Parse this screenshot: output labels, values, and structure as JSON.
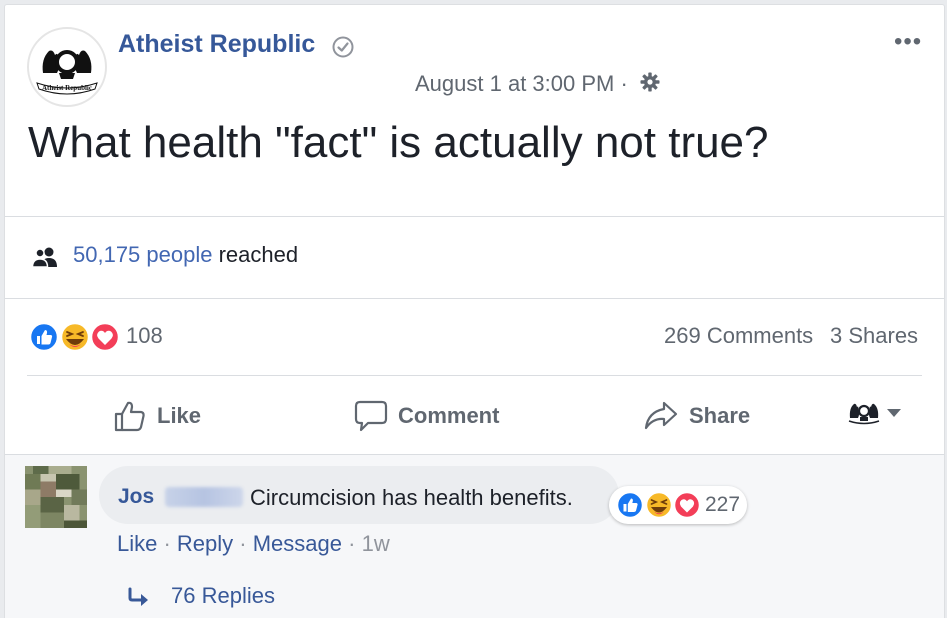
{
  "post": {
    "page_name": "Atheist Republic",
    "logo_text": "Atheist Republic",
    "timestamp": "August 1 at 3:00 PM ·",
    "text": "What health \"fact\" is actually not true?",
    "more_label": "•••"
  },
  "reach": {
    "count": "50,175 people",
    "suffix": " reached"
  },
  "stats": {
    "reaction_count": "108",
    "comments": "269 Comments",
    "shares": "3 Shares"
  },
  "actions": {
    "like": "Like",
    "comment": "Comment",
    "share": "Share"
  },
  "comment": {
    "author": "Jos",
    "text": "Circumcision has health benefits.",
    "reaction_count": "227",
    "like": "Like",
    "reply": "Reply",
    "message": "Message",
    "sep": " · ",
    "time": "1w",
    "replies": "76 Replies"
  },
  "colors": {
    "link_blue": "#365899",
    "reach_blue": "#4267b2",
    "like_blue": "#1877f2",
    "love_red": "#f33e58",
    "haha_yellow": "#f7b928"
  },
  "icons": [
    "verified-badge-icon",
    "gear-icon",
    "people-icon",
    "like-reaction-icon",
    "haha-reaction-icon",
    "love-reaction-icon",
    "thumbs-up-icon",
    "speech-bubble-icon",
    "share-arrow-icon",
    "chevron-down-icon",
    "reply-arrow-icon"
  ]
}
